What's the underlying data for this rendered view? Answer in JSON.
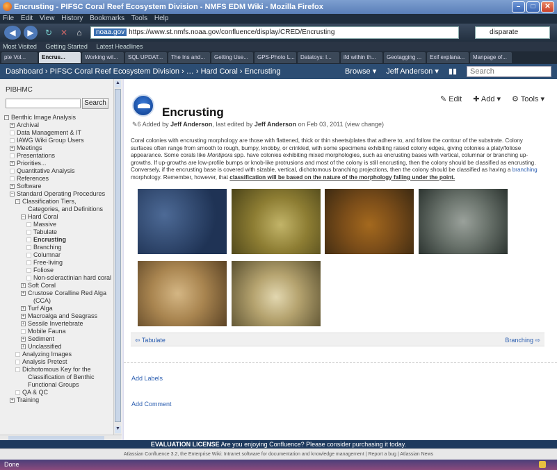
{
  "window": {
    "title": "Encrusting - PIFSC Coral Reef Ecosystem Division - NMFS EDM Wiki - Mozilla Firefox"
  },
  "menubar": [
    "File",
    "Edit",
    "View",
    "History",
    "Bookmarks",
    "Tools",
    "Help"
  ],
  "navbar": {
    "url_domain": "noaa.gov",
    "url": "https://www.st.nmfs.noaa.gov/confluence/display/CRED/Encrusting",
    "search_value": "disparate"
  },
  "bookmarks": [
    "Most Visited",
    "Getting Started",
    "Latest Headlines"
  ],
  "tabs": [
    "pte Vol...",
    "Encrus...",
    "Working wit...",
    "SQL UPDAT...",
    "The Ins and...",
    "Getting Use...",
    "GPS-Photo L...",
    "Datatoys: I...",
    "ifd within th...",
    "Geotagging ...",
    "Exif explana...",
    "Manpage of..."
  ],
  "confluence_bar": {
    "breadcrumb": "Dashboard › PIFSC Coral Reef Ecosystem Division › … › Hard Coral › Encrusting",
    "browse": "Browse ▾",
    "user": "Jeff Anderson ▾",
    "search_placeholder": "Search"
  },
  "sidebar": {
    "title": "PIBHMC",
    "search_button": "Search",
    "tree": [
      {
        "label": "Benthic Image Analysis",
        "box": "⊟",
        "indent": 0
      },
      {
        "label": "Archival",
        "box": "⊞",
        "indent": 1
      },
      {
        "label": "Data Management & IT",
        "box": "",
        "indent": 1
      },
      {
        "label": "IAWG Wiki Group Users",
        "box": "",
        "indent": 1
      },
      {
        "label": "Meetings",
        "box": "⊞",
        "indent": 1
      },
      {
        "label": "Presentations",
        "box": "",
        "indent": 1
      },
      {
        "label": "Priorities...",
        "box": "⊞",
        "indent": 1
      },
      {
        "label": "Quantitative Analysis",
        "box": "",
        "indent": 1
      },
      {
        "label": "References",
        "box": "",
        "indent": 1
      },
      {
        "label": "Software",
        "box": "⊞",
        "indent": 1
      },
      {
        "label": "Standard Operating Procedures",
        "box": "⊟",
        "indent": 1
      },
      {
        "label": "Classification Tiers,",
        "box": "⊟",
        "indent": 2
      },
      {
        "label": "Categories, and Definitions",
        "box": "none",
        "indent": 3
      },
      {
        "label": "Hard Coral",
        "box": "⊟",
        "indent": 3
      },
      {
        "label": "Massive",
        "box": "",
        "indent": 4
      },
      {
        "label": "Tabulate",
        "box": "",
        "indent": 4
      },
      {
        "label": "Encrusting",
        "box": "",
        "indent": 4,
        "selected": true
      },
      {
        "label": "Branching",
        "box": "",
        "indent": 4
      },
      {
        "label": "Columnar",
        "box": "",
        "indent": 4
      },
      {
        "label": "Free-living",
        "box": "",
        "indent": 4
      },
      {
        "label": "Foliose",
        "box": "",
        "indent": 4
      },
      {
        "label": "Non-scleractinian hard coral",
        "box": "",
        "indent": 4
      },
      {
        "label": "Soft Coral",
        "box": "⊞",
        "indent": 3
      },
      {
        "label": "Crustose Coralline Red Alga",
        "box": "⊞",
        "indent": 3
      },
      {
        "label": "(CCA)",
        "box": "none",
        "indent": 4
      },
      {
        "label": "Turf Alga",
        "box": "⊞",
        "indent": 3
      },
      {
        "label": "Macroalga and Seagrass",
        "box": "⊞",
        "indent": 3
      },
      {
        "label": "Sessile Invertebrate",
        "box": "⊞",
        "indent": 3
      },
      {
        "label": "Mobile Fauna",
        "box": "",
        "indent": 3
      },
      {
        "label": "Sediment",
        "box": "⊞",
        "indent": 3
      },
      {
        "label": "Unclassified",
        "box": "⊞",
        "indent": 3
      },
      {
        "label": "Analyzing Images",
        "box": "",
        "indent": 2
      },
      {
        "label": "Analysis Pretest",
        "box": "",
        "indent": 2
      },
      {
        "label": "Dichotomous Key for the",
        "box": "",
        "indent": 2
      },
      {
        "label": "Classification of Benthic",
        "box": "none",
        "indent": 3
      },
      {
        "label": "Functional Groups",
        "box": "none",
        "indent": 3
      },
      {
        "label": "QA & QC",
        "box": "",
        "indent": 2
      },
      {
        "label": "Training",
        "box": "⊞",
        "indent": 1
      }
    ]
  },
  "page": {
    "title": "Encrusting",
    "meta_count": "6",
    "meta_added": "Added by",
    "meta_author": "Jeff Anderson",
    "meta_edited": ", last edited by",
    "meta_editor": "Jeff Anderson",
    "meta_date": "on Feb 03, 2011",
    "meta_view": "(view change)",
    "edit": "Edit",
    "add": "Add ▾",
    "tools": "Tools ▾",
    "desc_1": "Coral colonies with encrusting morphology are those with flattened, thick or thin sheets/plates that adhere to, and follow the contour of the substrate.  Colony surfaces often range from smooth to rough, bumpy, knobby, or crinkled, with some specimens exhibiting raised colony edges, giving colonies a platy/foliose appearance.  Some corals like ",
    "desc_italic": "Montipora",
    "desc_2": " spp. have colonies exhibiting mixed morphologies, such as encrusting bases with vertical, columnar or branching up-growths.  If up-growths are low-profile bumps or knob-like protrusions and most of the colony is still encrusting, then the colony should be classified as encrusting.  Conversely, if the encrusting base is covered with sizable, vertical, dichotomous branching projections, then the colony should be classified as having a ",
    "desc_link": "branching",
    "desc_3": " morphology.  Remember, however, that ",
    "desc_bold": "classification will be based on the nature of the morphology falling under the point.",
    "prev": "Tabulate",
    "next": "Branching",
    "add_labels": "Add Labels",
    "add_comment": "Add Comment"
  },
  "eval": {
    "strong": "EVALUATION LICENSE",
    "text": " Are you enjoying Confluence? Please consider purchasing it today."
  },
  "footer": "Atlassian Confluence 3.2, the Enterprise Wiki: Intranet software for documentation and knowledge management  |  Report a bug  |  Atlassian News",
  "status": "Done"
}
